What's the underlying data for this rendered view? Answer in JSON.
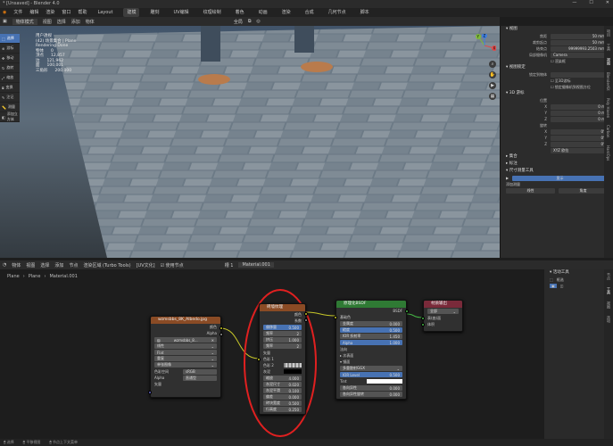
{
  "window": {
    "title": "* [Unsaved] - Blender 4.0"
  },
  "menu": {
    "items": [
      "文件",
      "编辑",
      "渲染",
      "窗口",
      "帮助"
    ],
    "workspaces": [
      "Layout",
      "建模",
      "雕刻",
      "UV编辑",
      "纹理绘制",
      "着色",
      "动画",
      "渲染",
      "合成",
      "几何节点",
      "脚本",
      "无限节点",
      "其他"
    ],
    "active_workspace": "建模"
  },
  "viewport": {
    "mode": "物体模式",
    "menus": [
      "视图",
      "选择",
      "添加",
      "物体"
    ],
    "transform_orient": "全局",
    "tools": [
      "选择",
      "游标",
      "移动",
      "旋转",
      "缩放",
      "变换",
      "注记",
      "测量",
      "添加立方体"
    ],
    "stats": {
      "title": "用户透视",
      "collection": "(42) 场景集合 | Plane",
      "render": "Rendering Done",
      "objects_label": "物体",
      "objects": "0",
      "vertices_label": "顶点",
      "vertices": "12,857",
      "edges_label": "边",
      "edges": "121,962",
      "faces_label": "面",
      "faces": "100,001",
      "tris_label": "三角形",
      "tris": "200,000"
    },
    "gizmo": {
      "x": "X",
      "y": "Y",
      "z": "Z"
    }
  },
  "sidepanel": {
    "view_header": "视图",
    "focal_label": "焦距",
    "focal": "50 mm",
    "clip_start_label": "裁剪起点",
    "clip_start": "50 mm",
    "clip_end_label": "结束点",
    "clip_end": "99999993.2503 mm",
    "local_camera_label": "局部摄像机",
    "local_camera": "Camera",
    "render_region": "渲染框",
    "view_lock_header": "视图锁定",
    "lock_object_label": "锁定到物体",
    "lock_3d_cursor": "至3D游标",
    "lock_cam": "锁定摄像机到视图方位",
    "cursor_header": "3D 游标",
    "location_label": "位置",
    "loc_x": "0 m",
    "loc_y": "0 m",
    "loc_z": "0 m",
    "rotation_label": "旋转",
    "rot_x": "0°",
    "rot_y": "0°",
    "rot_z": "0°",
    "rot_mode": "XYZ 欧拉",
    "collection_header": "集合",
    "annotation_header": "标注",
    "measure_header": "尺寸测量工具",
    "measure_btn": "显示",
    "add_measure_label": "添加测量",
    "measure_opts": [
      "线性",
      "角度"
    ]
  },
  "tabs_right": [
    "项目",
    "工具",
    "视图",
    "BlenderKit",
    "Poly Haven",
    "Carbon",
    "HardOps",
    "Measure"
  ],
  "node_editor": {
    "header": [
      "物体",
      "视图",
      "选择",
      "添加",
      "节点",
      "渲染区域 (Turbo Tools)",
      "[UV文化]"
    ],
    "use_nodes": "使用节点",
    "slot": "槽 1",
    "material": "Material.001",
    "breadcrumb": [
      "Plane",
      "Plane",
      "Material.001"
    ],
    "image_node": {
      "title": "wzmsbbs_8K_Albedo.jpg",
      "out_color": "颜色",
      "out_alpha": "Alpha",
      "image": "wzmsbbs_8...",
      "interp": "线性",
      "proj": "Flat",
      "ext": "重复",
      "source": "单张图像",
      "colorspace_label": "色彩空间",
      "colorspace": "sRGB",
      "alpha_label": "Alpha",
      "alpha": "直通型",
      "vector": "矢量"
    },
    "brick_node": {
      "title": "砖墙纹理",
      "out_color": "颜色",
      "out_fac": "系数",
      "offset_label": "偏移量",
      "offset": "0.500",
      "freq_label": "频率",
      "freq": "2",
      "squash_label": "挤压",
      "squash": "1.000",
      "freq2_label": "频率",
      "freq2": "2",
      "vector": "矢量",
      "color1": "色彩 1",
      "color2": "色彩 2",
      "mortar": "灰泥",
      "scale_label": "缩放",
      "scale": "4.000",
      "mortar_size_label": "灰泥尺寸",
      "mortar_size": "0.020",
      "mortar_smooth_label": "灰泥平滑",
      "mortar_smooth": "0.100",
      "bias_label": "偏差",
      "bias": "0.000",
      "brick_width_label": "砖块宽度",
      "brick_width": "0.500",
      "row_height_label": "行高度",
      "row_height": "0.250"
    },
    "bsdf_node": {
      "title": "原理化BSDF",
      "out": "BSDF",
      "base_color": "基础色",
      "metallic_label": "金属度",
      "metallic": "0.000",
      "roughness_label": "糙度",
      "roughness": "0.500",
      "ior_label": "IOR 折射率",
      "ior": "1.450",
      "alpha_label": "Alpha",
      "alpha": "1.000",
      "normal": "法向",
      "subsurface": "次表面",
      "specular": "镜面",
      "dist": "多重散射GGX",
      "ior_level_label": "IOR Level",
      "ior_level": "0.500",
      "tint_label": "Tint",
      "aniso_label": "各向异性",
      "aniso": "0.000",
      "aniso_rot_label": "各向异性旋转",
      "aniso_rot": "0.000",
      "tangent": "切向(切线)",
      "transmission": "透射",
      "coat": "涂层",
      "sheen": "光泽",
      "emission": "自发光(发射)"
    },
    "output_node": {
      "title": "材质输出",
      "target": "全部",
      "surface": "表(曲)面",
      "volume": "体积",
      "displacement": "置换"
    }
  },
  "npanel": {
    "header": "活动工具",
    "select": "框选"
  },
  "ntabs": [
    "节点",
    "工具",
    "视图",
    "选项",
    "Node Wrangler"
  ],
  "statusbar": [
    "选择",
    "平移视图",
    "节点上下文菜单"
  ]
}
